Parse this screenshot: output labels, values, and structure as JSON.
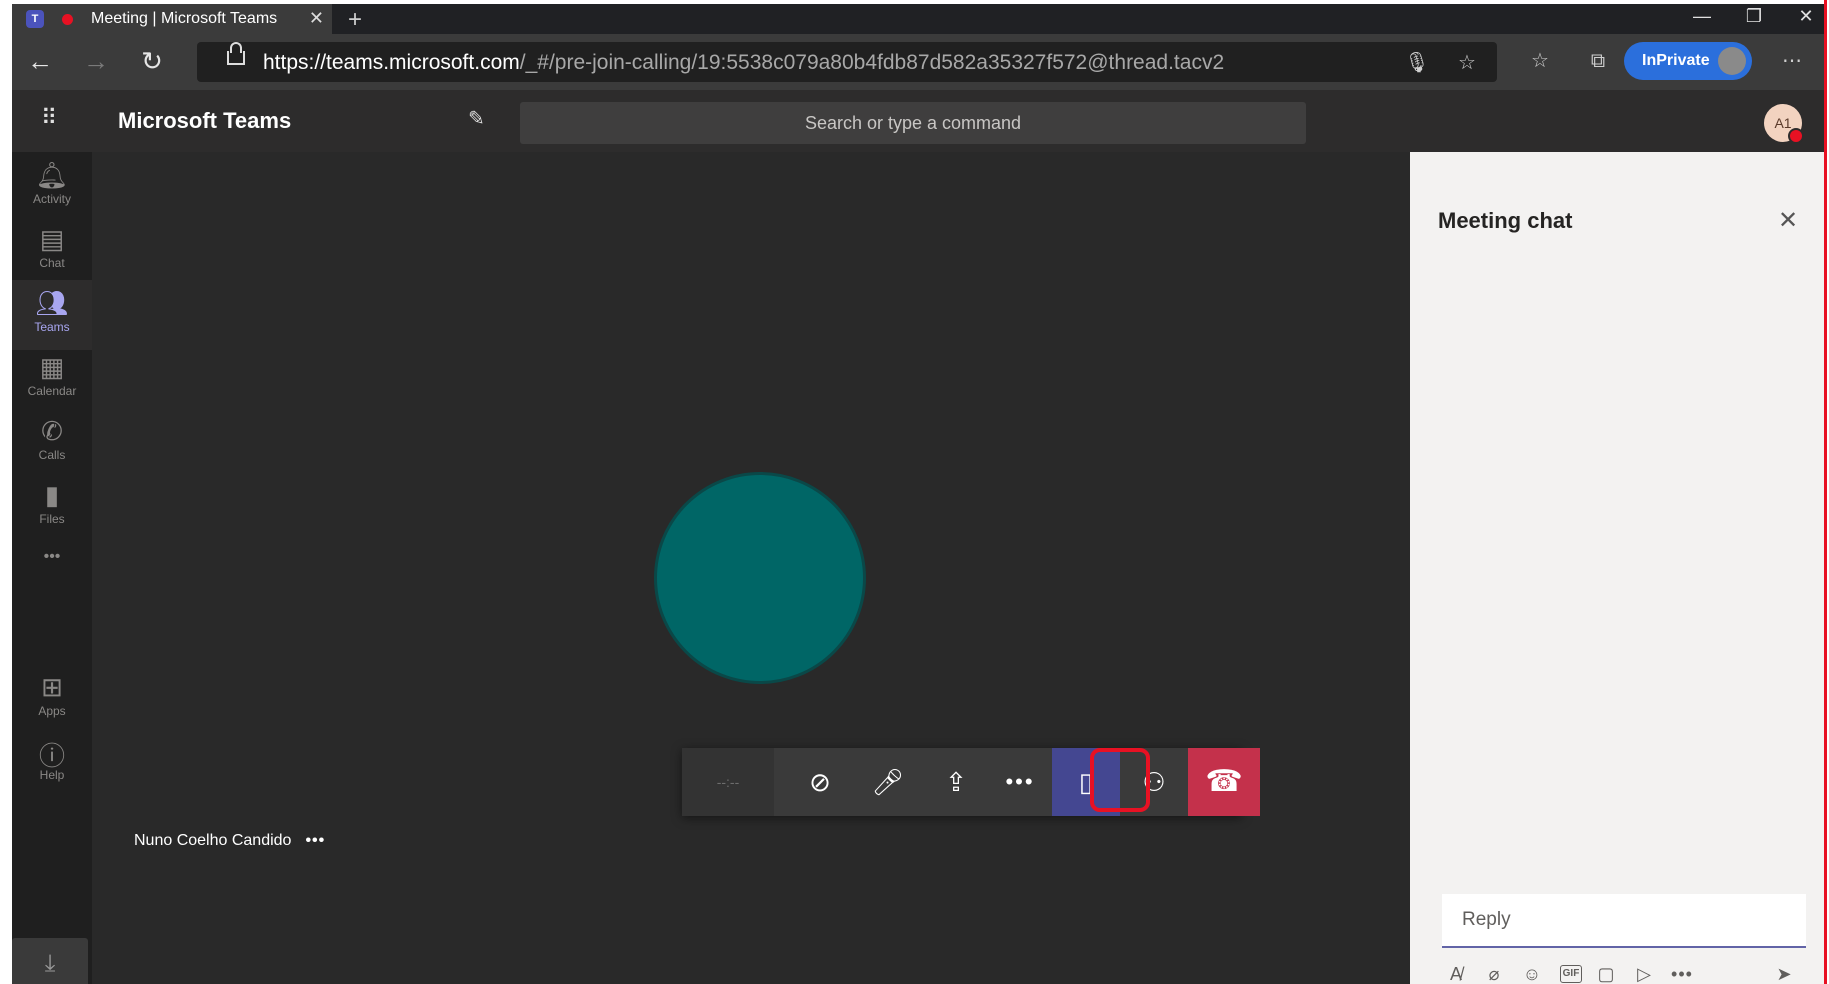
{
  "browser": {
    "tab_title": "Meeting | Microsoft Teams",
    "tab_close": "✕",
    "new_tab": "+",
    "url_host": "https://teams.microsoft.com",
    "url_path": "/_#/pre-join-calling/19:5538c079a80b4fdb87d582a35327f572@thread.tacv2",
    "inprivate_label": "InPrivate",
    "window_controls": {
      "minimize": "—",
      "restore": "❐",
      "close": "✕"
    }
  },
  "teams_header": {
    "app_title": "Microsoft Teams",
    "search_placeholder": "Search or type a command",
    "user_initials": "A1"
  },
  "rail": {
    "items": [
      {
        "label": "Activity",
        "icon": "bell-icon"
      },
      {
        "label": "Chat",
        "icon": "chat-icon"
      },
      {
        "label": "Teams",
        "icon": "teams-icon"
      },
      {
        "label": "Calendar",
        "icon": "calendar-icon"
      },
      {
        "label": "Calls",
        "icon": "phone-icon"
      },
      {
        "label": "Files",
        "icon": "file-icon"
      }
    ],
    "more": "•••",
    "apps_label": "Apps",
    "help_label": "Help"
  },
  "stage": {
    "participant_name": "Nuno Coelho Candido",
    "participant_more": "•••",
    "avatar_color": "#006666"
  },
  "controls": {
    "timer": "--:--",
    "more": "•••"
  },
  "chat_panel": {
    "title": "Meeting chat",
    "reply_placeholder": "Reply"
  },
  "colors": {
    "accent": "#6264a7",
    "hangup": "#c4314b",
    "highlight": "#e81123",
    "inprivate": "#2b6fdc"
  }
}
